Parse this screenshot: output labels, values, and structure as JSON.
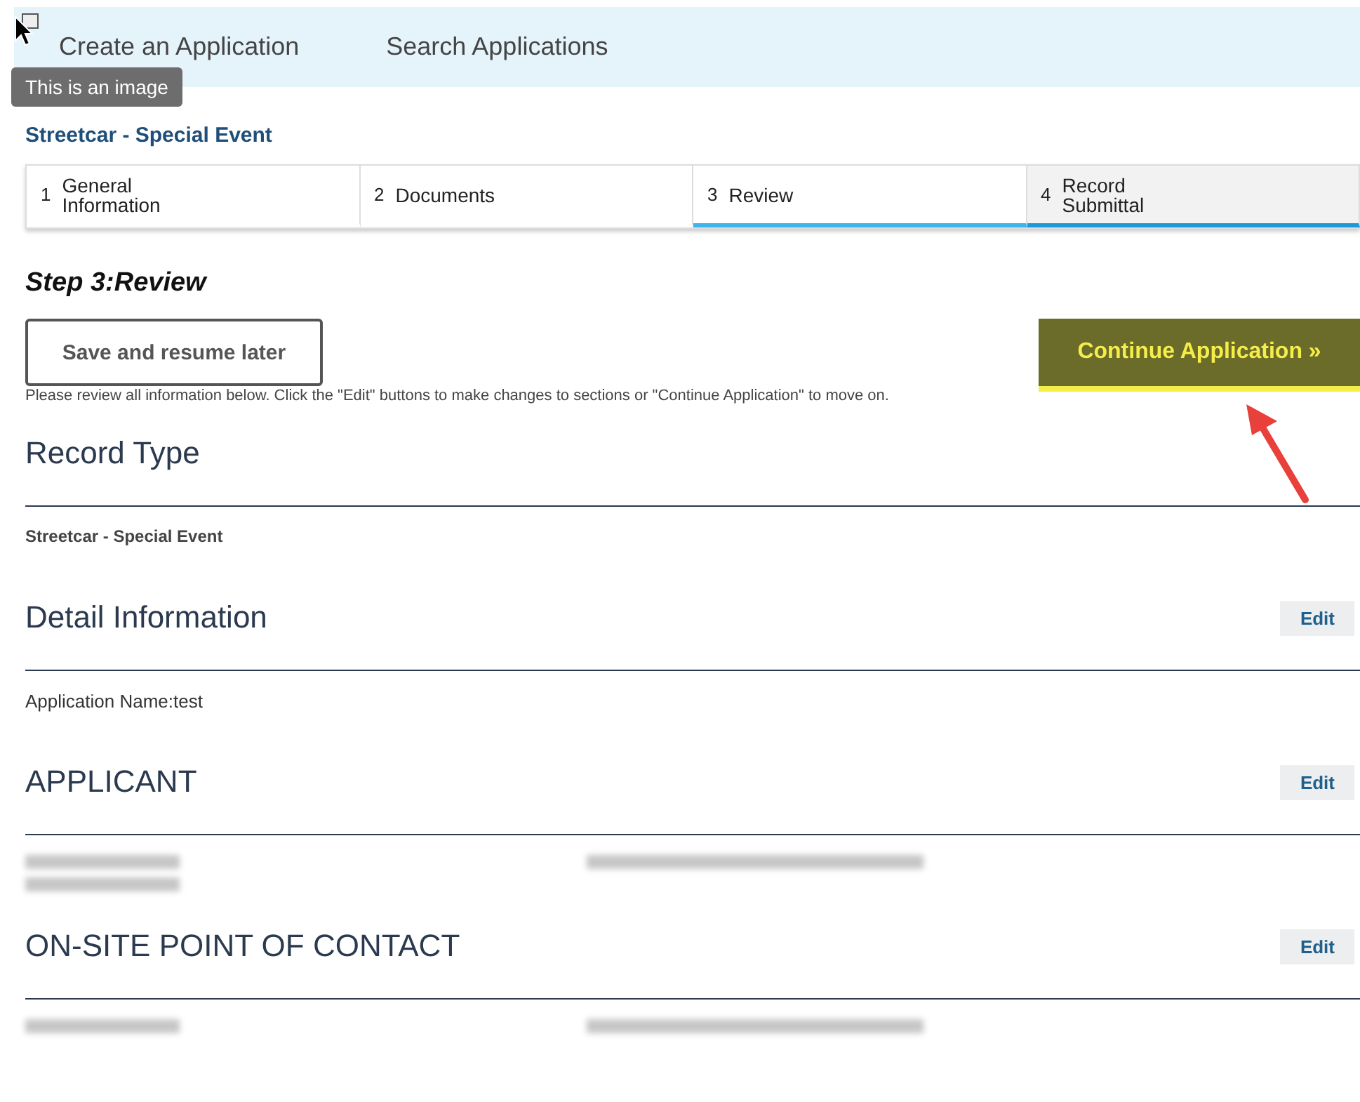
{
  "nav": {
    "links": [
      {
        "label": "Create an Application"
      },
      {
        "label": "Search Applications"
      }
    ],
    "tooltip": "This is an image"
  },
  "record_title": "Streetcar - Special Event",
  "steps": [
    {
      "number": "1",
      "label": "General Information",
      "selected": false,
      "upcoming": false
    },
    {
      "number": "2",
      "label": "Documents",
      "selected": false,
      "upcoming": false
    },
    {
      "number": "3",
      "label": "Review",
      "selected": true,
      "upcoming": false
    },
    {
      "number": "4",
      "label": "Record Submittal",
      "selected": false,
      "upcoming": true
    }
  ],
  "step_heading": "Step 3:Review",
  "buttons": {
    "save": "Save and resume later",
    "continue": "Continue Application »"
  },
  "instructions": "Please review all information below. Click the \"Edit\" buttons to make changes to sections or \"Continue Application\" to move on.",
  "sections": [
    {
      "title": "Record Type",
      "left": [
        {
          "kind": "strong",
          "text": "Streetcar - Special Event"
        }
      ]
    },
    {
      "title": "Detail Information",
      "edit": "Edit",
      "left": [
        {
          "kind": "text",
          "text": "Application Name:test"
        }
      ]
    },
    {
      "title": "APPLICANT",
      "edit": "Edit",
      "left": [
        {
          "kind": "blurred"
        },
        {
          "kind": "blurred"
        }
      ],
      "right": [
        {
          "kind": "blurred"
        }
      ]
    },
    {
      "title": "ON-SITE POINT OF CONTACT",
      "edit": "Edit",
      "left": [
        {
          "kind": "blurred"
        }
      ],
      "right": [
        {
          "kind": "blurred"
        }
      ]
    }
  ]
}
